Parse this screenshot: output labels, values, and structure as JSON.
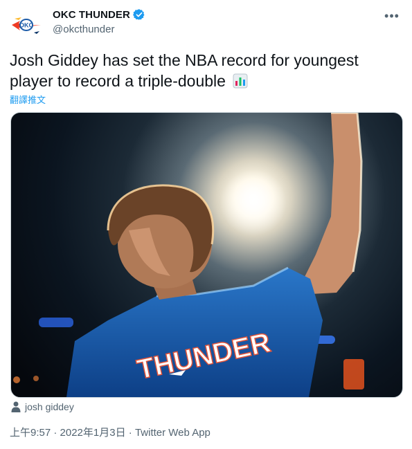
{
  "tweet": {
    "author": {
      "display_name": "OKC THUNDER",
      "handle": "@okcthunder",
      "verified": true,
      "avatar_icon": "okc-thunder-logo-icon"
    },
    "more_icon": "more-dots-icon",
    "text": "Josh Giddey has set the NBA record for youngest player to record a triple-double",
    "emoji_icon": "bar-chart-emoji-icon",
    "translate_label": "翻譯推文",
    "media": {
      "alt_tag_icon": "person-icon",
      "tagged_user": "josh giddey"
    },
    "timestamp": "上午9:57 · 2022年1月3日",
    "separator": " · ",
    "source": "Twitter Web App"
  },
  "colors": {
    "accent": "#1d9bf0",
    "text_primary": "#0f1419",
    "text_secondary": "#536471"
  }
}
